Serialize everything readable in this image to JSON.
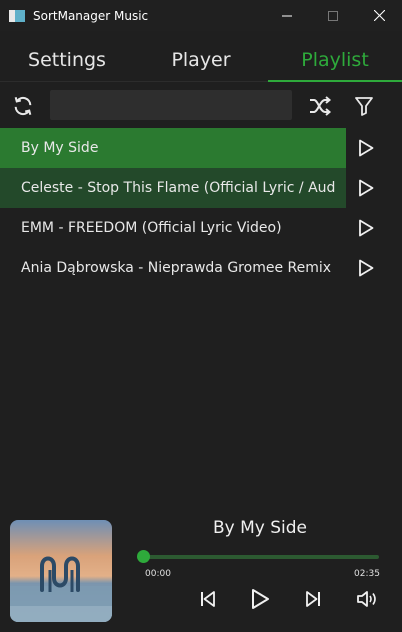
{
  "window": {
    "title": "SortManager Music"
  },
  "tabs": [
    {
      "label": "Settings"
    },
    {
      "label": "Player"
    },
    {
      "label": "Playlist"
    }
  ],
  "search": {
    "value": "",
    "placeholder": ""
  },
  "playlist": [
    {
      "title": "By My Side",
      "state": "playing"
    },
    {
      "title": "Celeste - Stop This Flame (Official Lyric / Audio)",
      "state": "hover"
    },
    {
      "title": "EMM - FREEDOM (Official Lyric Video)",
      "state": ""
    },
    {
      "title": "Ania Dąbrowska - Nieprawda Gromee Remix (Audio)",
      "state": ""
    }
  ],
  "now_playing": {
    "title": "By My Side",
    "elapsed": "00:00",
    "duration": "02:35",
    "progress": 0.0
  },
  "colors": {
    "accent": "#2eaa3b",
    "background": "#1f1f1f",
    "selected_row": "#2b7a30",
    "hover_row": "#23492a"
  }
}
